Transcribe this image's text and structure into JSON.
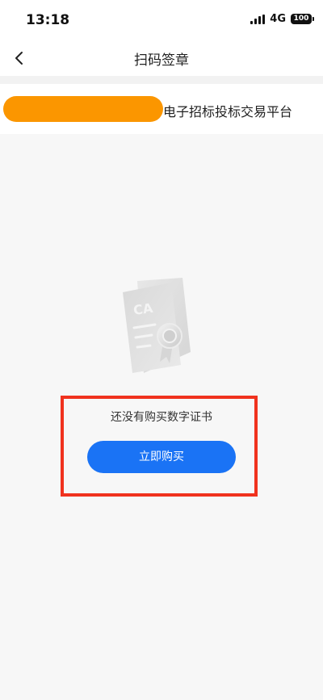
{
  "status_bar": {
    "time": "13:18",
    "network": "4G",
    "battery": "100"
  },
  "nav": {
    "title": "扫码签章"
  },
  "platform": {
    "name": "电子招标投标交易平台"
  },
  "empty_state": {
    "message": "还没有购买数字证书",
    "button_label": "立即购买",
    "illustration_text": "CA"
  },
  "colors": {
    "primary": "#1a73f5",
    "redaction": "#fb9600",
    "highlight": "#f0321e"
  }
}
